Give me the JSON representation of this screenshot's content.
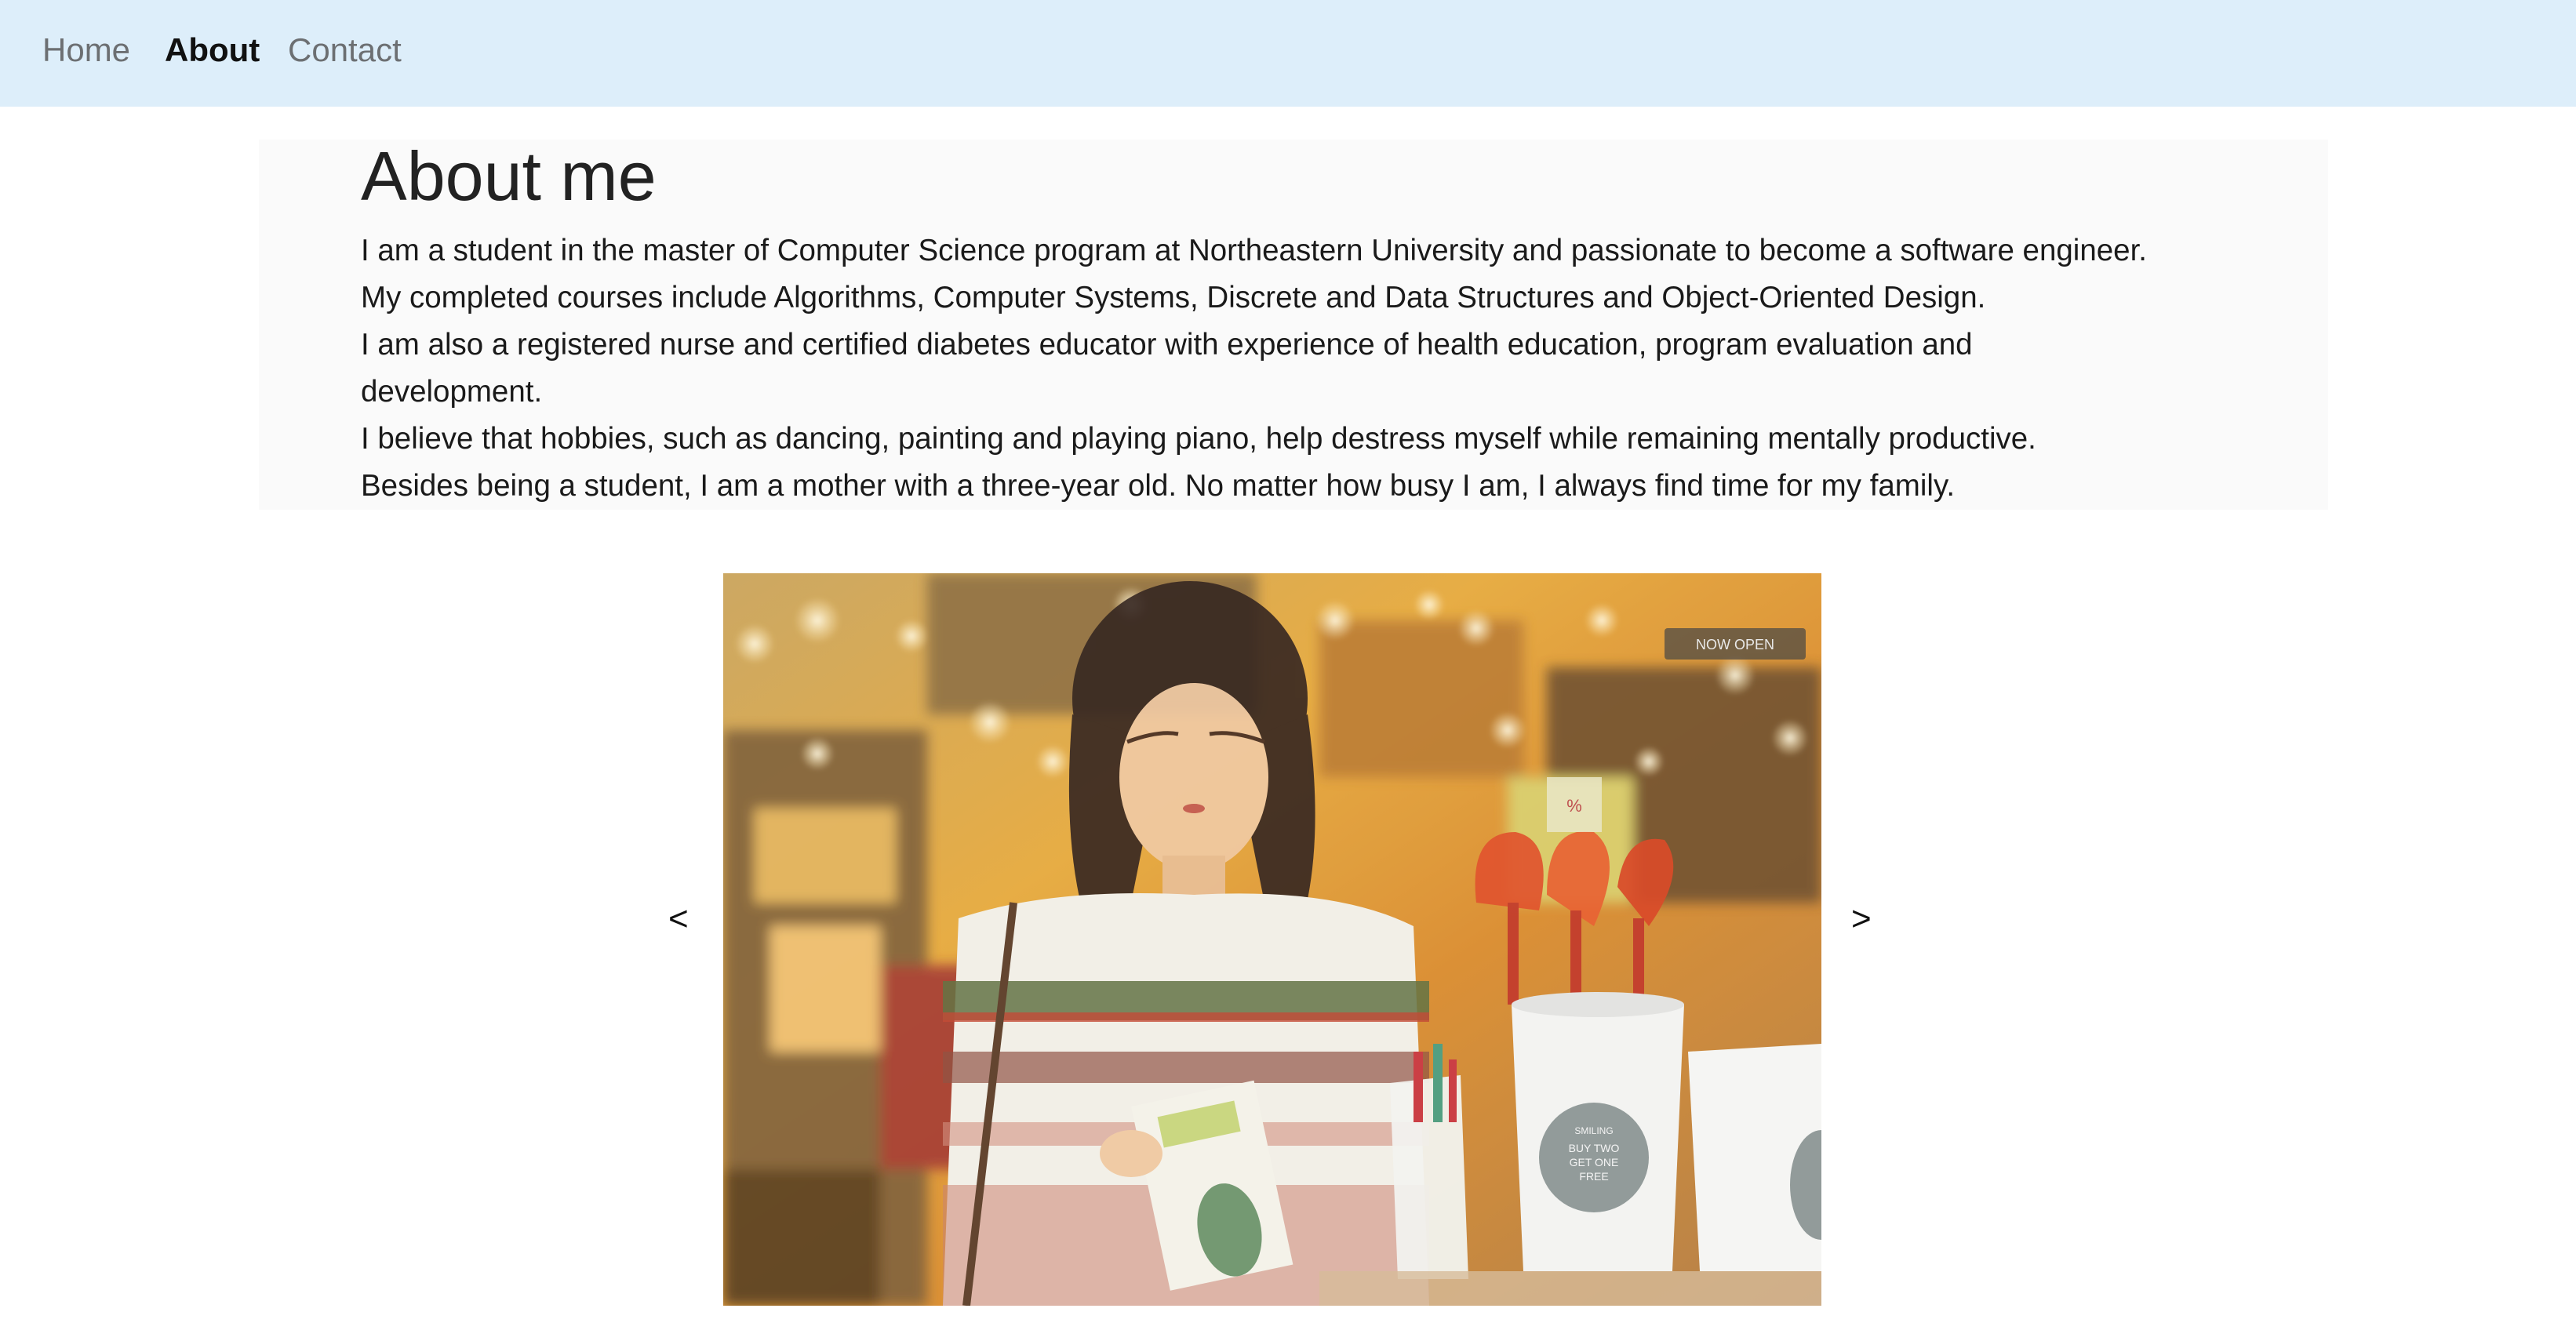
{
  "nav": {
    "items": [
      {
        "label": "Home",
        "active": false
      },
      {
        "label": "About",
        "active": true
      },
      {
        "label": "Contact",
        "active": false
      }
    ]
  },
  "about": {
    "title": "About me",
    "paragraphs": [
      "I am a student in the master of Computer Science program at Northeastern University and passionate to become a software engineer.",
      "My completed courses include Algorithms, Computer Systems, Discrete and Data Structures and Object-Oriented Design.",
      "I am also a registered nurse and certified diabetes educator with experience of health education, program evaluation and development.",
      "I believe that hobbies, such as dancing, painting and playing piano, help destress myself while remaining mentally productive.",
      "Besides being a student, I am a mother with a three-year old. No matter how busy I am, I always find time for my family."
    ]
  },
  "carousel": {
    "prev_label": "<",
    "next_label": ">",
    "photo_text": {
      "sign": "NOW OPEN",
      "tag": "%",
      "cup_label": [
        "SMILING",
        "BUY TWO",
        "GET ONE",
        "FREE"
      ]
    }
  },
  "colors": {
    "nav_background": "#ddeefa",
    "about_background": "#fafafa",
    "active_link": "#111111",
    "inactive_link": "#6c6f72"
  }
}
